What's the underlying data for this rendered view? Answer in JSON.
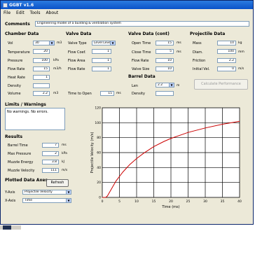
{
  "window": {
    "title": "GGBT v1.6"
  },
  "menu": [
    "File",
    "Edit",
    "Tools",
    "About"
  ],
  "comments": {
    "label": "Comments",
    "value": "Engineering model of a building & ventilation system"
  },
  "chamber": {
    "header": "Chamber Data",
    "vol": {
      "label": "Vol",
      "value": "30",
      "unit": "m3"
    },
    "temperature": {
      "label": "Temperature",
      "value": "20",
      "unit": ""
    },
    "pressure": {
      "label": "Pressure",
      "value": "100",
      "unit": "kPa"
    },
    "flow_rate": {
      "label": "Flow Rate",
      "value": "15",
      "unit": "m3/h"
    },
    "heat_rate": {
      "label": "Heat Rate",
      "value": "1",
      "unit": ""
    },
    "density": {
      "label": "Density",
      "value": "",
      "unit": ""
    },
    "volume": {
      "label": "Volume",
      "value": "2.2",
      "unit": "m3"
    }
  },
  "valve": {
    "header": "Valve Data",
    "type": {
      "label": "Valve Type",
      "value": "Level Level"
    },
    "coef": {
      "label": "Flow Coef.",
      "value": "1",
      "unit": ""
    },
    "area": {
      "label": "Flow Area",
      "value": "1",
      "unit": ""
    },
    "rate": {
      "label": "Flow Rate",
      "value": "1",
      "unit": ""
    },
    "time": {
      "label": "Time to Open",
      "value": "15",
      "unit": "ms"
    }
  },
  "valve_cont": {
    "header": "Valve Data (cont)",
    "rows": [
      {
        "label": "Open Time",
        "value": "15",
        "unit": "ms"
      },
      {
        "label": "Close Time",
        "value": "5",
        "unit": "ms"
      },
      {
        "label": "Flow Rate",
        "value": "10",
        "unit": ""
      },
      {
        "label": "Valve Size",
        "value": "10",
        "unit": ""
      }
    ]
  },
  "barrel": {
    "header": "Barrel Data",
    "rows": [
      {
        "label": "Len",
        "value": "2.2",
        "unit": "m"
      },
      {
        "label": "Density",
        "value": "",
        "unit": ""
      }
    ]
  },
  "projectile": {
    "header": "Projectile Data",
    "rows": [
      {
        "label": "Mass",
        "value": "10",
        "unit": "kg"
      },
      {
        "label": "Diam.",
        "value": "100",
        "unit": "mm"
      },
      {
        "label": "Friction",
        "value": "2.2",
        "unit": ""
      },
      {
        "label": "Initial Vel.",
        "value": "0",
        "unit": "m/s"
      }
    ]
  },
  "calc_button": "Calculate Performance",
  "limits": {
    "header": "Limits / Warnings",
    "text": "No warnings. No errors."
  },
  "results": {
    "header": "Results",
    "rows": [
      {
        "label": "Barrel Time",
        "value": "7",
        "unit": "ms"
      },
      {
        "label": "Max Pressure",
        "value": "2",
        "unit": "kPa"
      },
      {
        "label": "Muzzle Energy",
        "value": "3.8",
        "unit": "kJ"
      },
      {
        "label": "Muzzle Velocity",
        "value": "111",
        "unit": "m/s"
      }
    ]
  },
  "plotted": {
    "header": "Plotted Data Axes",
    "refresh_label": "Refresh",
    "y_axis": {
      "label": "Y-Axis",
      "value": "Projectile Velocity"
    },
    "x_axis": {
      "label": "X-Axis",
      "value": "Time"
    }
  },
  "chart_data": {
    "type": "line",
    "xlabel": "Time (ms)",
    "ylabel": "Projectile Velocity (m/s)",
    "xlim": [
      0,
      40
    ],
    "ylim": [
      0,
      120
    ],
    "xticks": [
      0,
      5,
      10,
      15,
      20,
      25,
      30,
      35,
      40
    ],
    "yticks": [
      0,
      20,
      40,
      60,
      80,
      100,
      120
    ],
    "grid": true,
    "line_color": "#cc0000",
    "x": [
      0,
      1,
      1.5,
      2,
      3,
      4,
      5,
      6,
      7,
      8,
      10,
      12,
      15,
      18,
      20,
      25,
      30,
      35,
      40
    ],
    "y": [
      0,
      0,
      2,
      6,
      14,
      22,
      28,
      34,
      39,
      44,
      52,
      59,
      68,
      75,
      79,
      87,
      93,
      98,
      102
    ]
  }
}
